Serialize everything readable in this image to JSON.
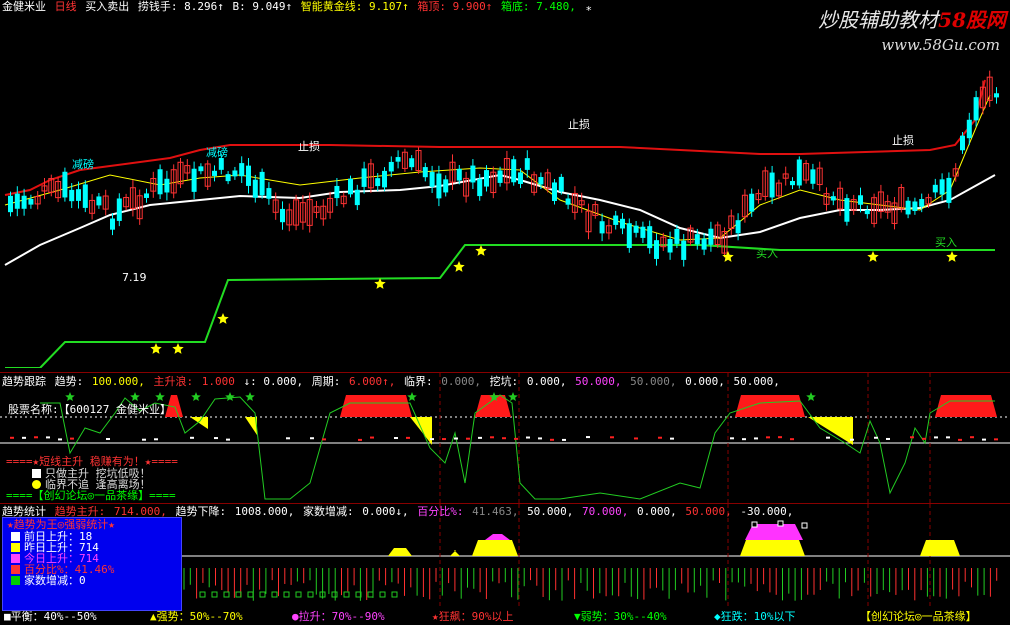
{
  "main_header": {
    "name": "金健米业",
    "period": "日线",
    "indicator": "买入卖出",
    "items": [
      {
        "label": "捞钱手:",
        "value": "8.296",
        "arrow": "↑",
        "color": "#ffffff"
      },
      {
        "label": "B:",
        "value": "9.049",
        "arrow": "↑",
        "color": "#ffffff"
      },
      {
        "label": "智能黄金线:",
        "value": "9.107",
        "arrow": "↑",
        "color": "#ffff00"
      },
      {
        "label": "箱顶:",
        "value": "9.900",
        "arrow": "↑",
        "color": "#ff3333"
      },
      {
        "label": "箱底:",
        "value": "7.480,",
        "arrow": "",
        "color": "#00ff00"
      }
    ]
  },
  "watermark": {
    "site_a": "炒股辅助教材",
    "site_b": "58股网",
    "url": "www.58Gu.com"
  },
  "chart_labels": {
    "stop_loss": "止损",
    "buy": "买入",
    "reduce": "减磅",
    "low_price": "7.19"
  },
  "trend_header": {
    "title": "趋势跟踪",
    "items": [
      {
        "text": "趋势:",
        "color": "#ffffff"
      },
      {
        "text": "100.000,",
        "color": "#ffff00"
      },
      {
        "text": "主升浪:",
        "color": "#ff3333"
      },
      {
        "text": "1.000",
        "color": "#ff3333"
      },
      {
        "text": "↓: 0.000,",
        "color": "#ffffff"
      },
      {
        "text": "周期:",
        "color": "#ffffff"
      },
      {
        "text": "6.000↑,",
        "color": "#ff3333"
      },
      {
        "text": "临界:",
        "color": "#ffffff"
      },
      {
        "text": "0.000,",
        "color": "#888888"
      },
      {
        "text": "挖坑:",
        "color": "#ffffff"
      },
      {
        "text": "0.000,",
        "color": "#ffffff"
      },
      {
        "text": "50.000,",
        "color": "#ff44ff"
      },
      {
        "text": "50.000,",
        "color": "#888888"
      },
      {
        "text": "0.000,",
        "color": "#ffffff"
      },
      {
        "text": "50.000,",
        "color": "#ffffff"
      }
    ]
  },
  "trend_info": {
    "stock_label": "股票名称:",
    "stock_value": "【600127 金健米业】",
    "banner": "====★短线主升 稳赚有为！★====",
    "line1": "只做主升 挖坑低吸！",
    "line2": "临界不追 逢高离场！",
    "footer": "====【创幻论坛◎一品茶缘】===="
  },
  "stats_header": {
    "title": "趋势统计",
    "items": [
      {
        "text": "趋势主升:",
        "color": "#ff3333"
      },
      {
        "text": "714.000,",
        "color": "#ff3333"
      },
      {
        "text": "趋势下降:",
        "color": "#ffffff"
      },
      {
        "text": "1008.000,",
        "color": "#ffffff"
      },
      {
        "text": "家数增减:",
        "color": "#ffffff"
      },
      {
        "text": "0.000↓,",
        "color": "#ffffff"
      },
      {
        "text": "百分比%:",
        "color": "#ff44ff"
      },
      {
        "text": "41.463,",
        "color": "#888888"
      },
      {
        "text": "50.000,",
        "color": "#ffffff"
      },
      {
        "text": "70.000,",
        "color": "#ff44ff"
      },
      {
        "text": "0.000,",
        "color": "#ffffff"
      },
      {
        "text": "50.000,",
        "color": "#ff3333"
      },
      {
        "text": "-30.000,",
        "color": "#ffffff"
      }
    ]
  },
  "stats_box": {
    "title": "★趋势为王◎强弱统计★",
    "rows": [
      {
        "label": "前日上升：18",
        "color": "#ffffff",
        "text_color": "#ffffff"
      },
      {
        "label": "昨日上升：714",
        "color": "#ffff00",
        "text_color": "#ffffff"
      },
      {
        "label": "今日上升：714",
        "color": "#ff44ff",
        "text_color": "#ff44ff"
      },
      {
        "label": "百分比%：41.46%",
        "color": "#ff3333",
        "text_color": "#ff3333"
      },
      {
        "label": "家数增减：0",
        "color": "#00cc00",
        "text_color": "#ffffff"
      }
    ]
  },
  "legend": [
    {
      "text": "■平衡：40%--50%",
      "color": "#ffffff"
    },
    {
      "text": "▲强势：50%--70%",
      "color": "#ffff00"
    },
    {
      "text": "●拉升：70%--90%",
      "color": "#ff44ff"
    },
    {
      "text": "★狂飙：90%以上",
      "color": "#ff3333"
    },
    {
      "text": "▼弱势：30%--40%",
      "color": "#00ff00"
    },
    {
      "text": "◆狂跌：10%以下",
      "color": "#00ffff"
    },
    {
      "text": "【创幻论坛◎一品茶缘】",
      "color": "#ffff00"
    }
  ],
  "colors": {
    "up": "#ff3333",
    "down": "#00ffff",
    "yellow": "#ffff00",
    "green": "#22dd22",
    "white": "#ffffff",
    "magenta": "#ff44ff"
  }
}
